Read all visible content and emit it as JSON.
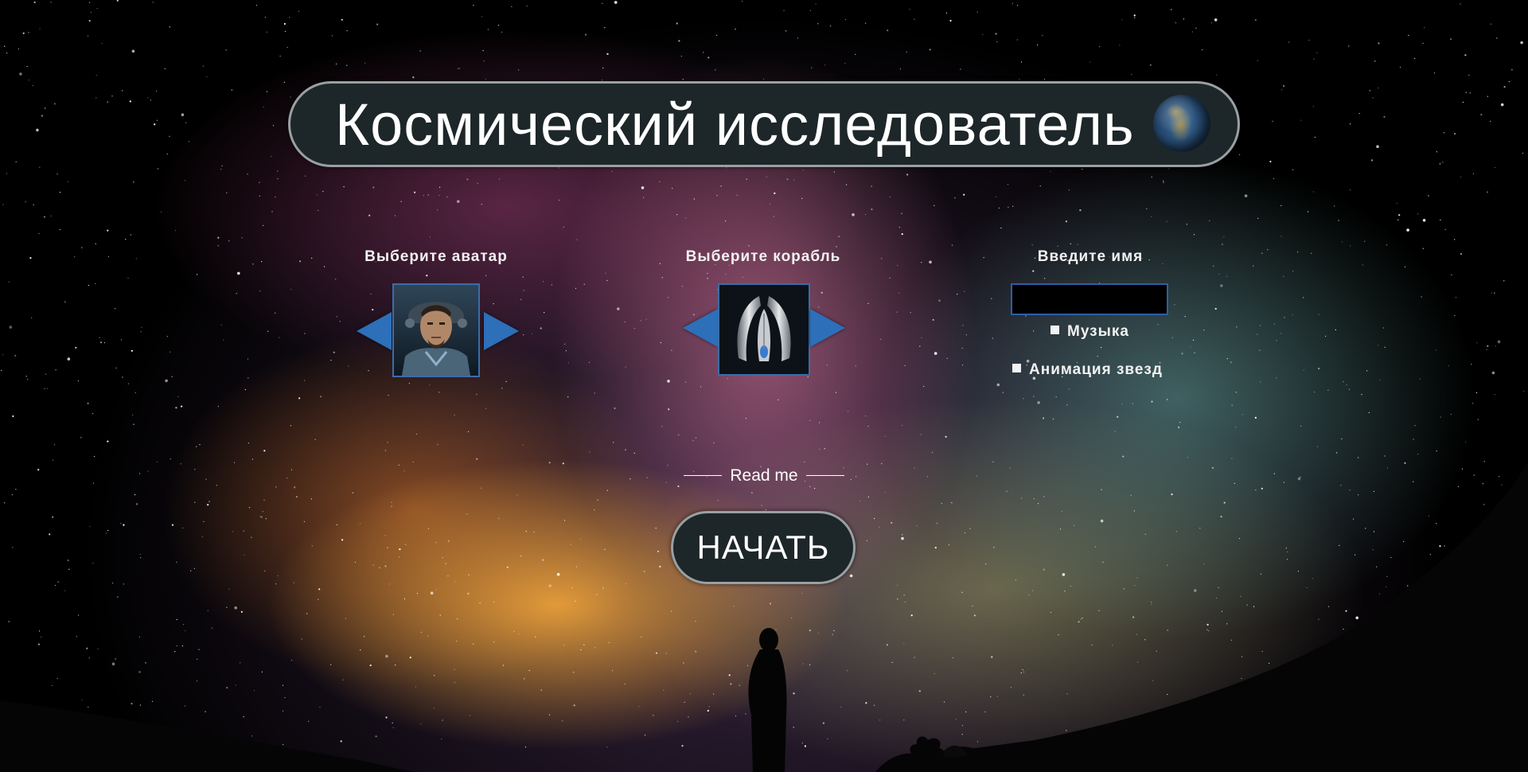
{
  "title": "Космический исследователь",
  "avatar_picker": {
    "label": "Выберите аватар"
  },
  "ship_picker": {
    "label": "Выберите корабль"
  },
  "name_entry": {
    "label": "Введите имя",
    "value": "",
    "placeholder": ""
  },
  "options": {
    "music_label": "Музыка",
    "star_animation_label": "Анимация звезд"
  },
  "readme_link": "Read me",
  "start_button": "НАЧАТЬ",
  "icons": {
    "title_icon": "globe-icon",
    "prev": "triangle-left-icon",
    "next": "triangle-right-icon"
  },
  "colors": {
    "panel_bg": "#1d2628",
    "panel_border": "#9aa0a2",
    "accent_blue": "#2d6fb8"
  }
}
